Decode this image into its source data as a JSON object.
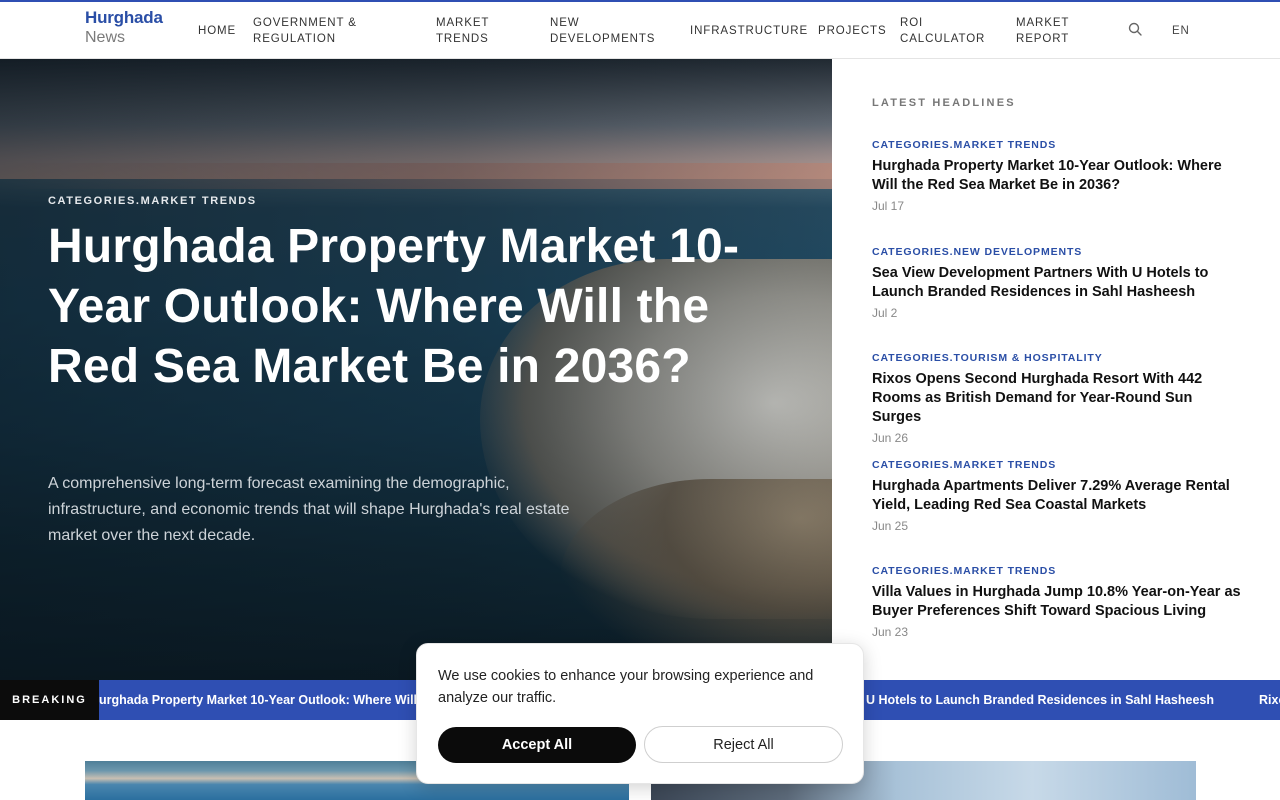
{
  "brand": {
    "name": "Hurghada",
    "sub": "News",
    "accent": "#2f4fb3"
  },
  "nav": {
    "items": [
      {
        "label_1": "HOME",
        "label_2": ""
      },
      {
        "label_1": "GOVERNMENT &",
        "label_2": "REGULATION"
      },
      {
        "label_1": "MARKET",
        "label_2": "TRENDS"
      },
      {
        "label_1": "NEW",
        "label_2": "DEVELOPMENTS"
      },
      {
        "label_1": "INFRASTRUCTURE",
        "label_2": ""
      },
      {
        "label_1": "PROJECTS",
        "label_2": ""
      },
      {
        "label_1": "ROI",
        "label_2": "CALCULATOR"
      },
      {
        "label_1": "MARKET",
        "label_2": "REPORT"
      }
    ],
    "search_icon": "search-icon",
    "language": "EN"
  },
  "hero": {
    "category": "CATEGORIES.MARKET TRENDS",
    "title": "Hurghada Property Market 10-Year Outlook: Where Will the Red Sea Market Be in 2036?",
    "description": "A comprehensive long-term forecast examining the demographic, infrastructure, and economic trends that will shape Hurghada's real estate market over the next decade."
  },
  "sidebar": {
    "title": "LATEST HEADLINES",
    "headlines": [
      {
        "category": "CATEGORIES.MARKET TRENDS",
        "title": "Hurghada Property Market 10-Year Outlook: Where Will the Red Sea Market Be in 2036?",
        "date": "Jul 17"
      },
      {
        "category": "CATEGORIES.NEW DEVELOPMENTS",
        "title": "Sea View Development Partners With U Hotels to Launch Branded Residences in Sahl Hasheesh",
        "date": "Jul 2"
      },
      {
        "category": "CATEGORIES.TOURISM & HOSPITALITY",
        "title": "Rixos Opens Second Hurghada Resort With 442 Rooms as British Demand for Year-Round Sun Surges",
        "date": "Jun 26"
      },
      {
        "category": "CATEGORIES.MARKET TRENDS",
        "title": "Hurghada Apartments Deliver 7.29% Average Rental Yield, Leading Red Sea Coastal Markets",
        "date": "Jun 25"
      },
      {
        "category": "CATEGORIES.MARKET TRENDS",
        "title": "Villa Values in Hurghada Jump 10.8% Year-on-Year as Buyer Preferences Shift Toward Spacious Living",
        "date": "Jun 23"
      }
    ]
  },
  "breaking": {
    "label": "BREAKING",
    "items": [
      "urghada Property Market 10-Year Outlook: Where Will the Red Sea Market Be in 2036?",
      "U Hotels to Launch Branded Residences in Sahl Hasheesh",
      "Rixo"
    ]
  },
  "cookie": {
    "text": "We use cookies to enhance your browsing experience and analyze our traffic.",
    "accept": "Accept All",
    "reject": "Reject All"
  }
}
